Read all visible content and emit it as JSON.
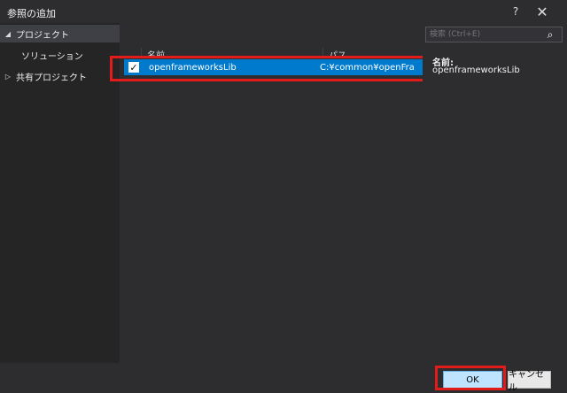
{
  "window": {
    "title": "参照の追加",
    "help": "?",
    "close": "✕"
  },
  "sidebar": {
    "items": [
      {
        "label": "プロジェクト",
        "arrow": "◢"
      },
      {
        "label": "ソリューション"
      },
      {
        "label": "共有プロジェクト",
        "arrow": "▷"
      }
    ]
  },
  "table": {
    "columns": [
      "名前",
      "パス"
    ],
    "rows": [
      {
        "checked": "✓",
        "name": "openframeworksLib",
        "path": "C:¥common¥openFra..."
      }
    ]
  },
  "search": {
    "placeholder": "検索 (Ctrl+E)",
    "icon": "⌕"
  },
  "details": {
    "label": "名前:",
    "value": "openframeworksLib"
  },
  "buttons": {
    "ok": "OK",
    "cancel": "キャンセル"
  },
  "colors": {
    "accent": "#007acc",
    "highlight": "#e21b1b"
  }
}
